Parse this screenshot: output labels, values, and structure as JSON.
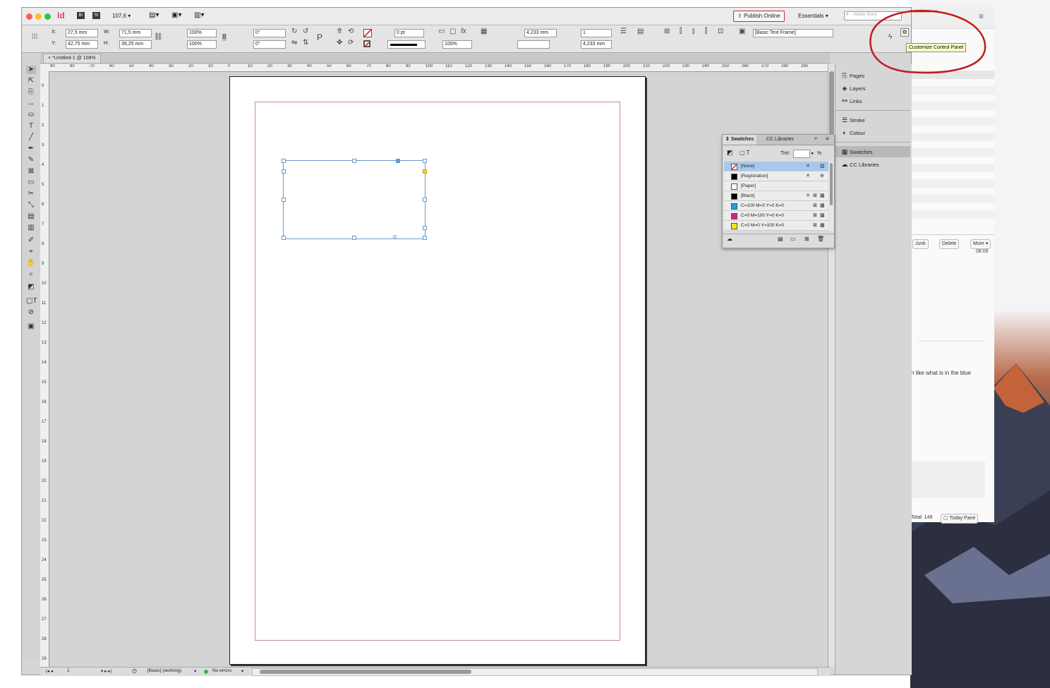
{
  "titlebar": {
    "app_icon": "Id",
    "br_label": "Br",
    "st_label": "St",
    "zoom": "107,6",
    "publish_online": "Publish Online",
    "workspace": "Essentials",
    "stock_search_placeholder": "Adobe Stock"
  },
  "control": {
    "x_label": "X:",
    "x_value": "27,5 mm",
    "y_label": "Y:",
    "y_value": "42,75 mm",
    "w_label": "W:",
    "w_value": "71,5 mm",
    "h_label": "H:",
    "h_value": "39,25 mm",
    "scale_x": "100%",
    "scale_y": "100%",
    "rotation": "0°",
    "shear": "0°",
    "stroke_weight": "0 pt",
    "opacity": "100%",
    "gutter_value1": "4,233 mm",
    "gutter_value2": "4,233 mm",
    "columns": "1",
    "object_style": "[Basic Text Frame]"
  },
  "document": {
    "tab_label": "*Untitled-1 @ 108%",
    "ruler_h": [
      "90",
      "80",
      "70",
      "60",
      "50",
      "40",
      "30",
      "20",
      "10",
      "0",
      "10",
      "20",
      "30",
      "40",
      "50",
      "60",
      "70",
      "80",
      "90",
      "100",
      "110",
      "120",
      "130",
      "140",
      "150",
      "160",
      "170",
      "180",
      "190",
      "200",
      "210",
      "220",
      "230",
      "240",
      "250",
      "260",
      "270",
      "280",
      "290"
    ],
    "ruler_v": [
      "0",
      "1",
      "2",
      "3",
      "4",
      "5",
      "6",
      "7",
      "8",
      "9",
      "10",
      "11",
      "12",
      "13",
      "14",
      "15",
      "16",
      "17",
      "18",
      "19",
      "20",
      "21",
      "22",
      "23",
      "24",
      "25",
      "26",
      "27",
      "28",
      "29"
    ]
  },
  "status": {
    "page": "1",
    "style": "[Basic] (working)",
    "preflight": "No errors"
  },
  "dock": {
    "items": [
      "Pages",
      "Layers",
      "Links",
      "Stroke",
      "Colour",
      "Swatches",
      "CC Libraries"
    ]
  },
  "swatches_panel": {
    "tab1": "Swatches",
    "tab2": "CC Libraries",
    "tint_label": "Tint:",
    "tint_unit": "%",
    "rows": [
      {
        "name": "[None]",
        "color": "#ffffff"
      },
      {
        "name": "[Registration]",
        "color": "#000000"
      },
      {
        "name": "[Paper]",
        "color": "#ffffff"
      },
      {
        "name": "[Black]",
        "color": "#000000"
      },
      {
        "name": "C=100 M=0 Y=0 K=0",
        "color": "#1ea0dc"
      },
      {
        "name": "C=0 M=100 Y=0 K=0",
        "color": "#d6237d"
      },
      {
        "name": "C=0 M=0 Y=100 K=0",
        "color": "#f7e612"
      }
    ]
  },
  "tooltip": "Customize Control Panel",
  "mail": {
    "junk": "Junk",
    "delete": "Delete",
    "more": "More",
    "time": "08:06",
    "snippet": "n like what is in the blue",
    "total": "Total: 149",
    "today_pane": "Today Pane"
  },
  "colors": {
    "annotation_red": "#c41a1a",
    "frame_blue": "#6a9ac8"
  }
}
